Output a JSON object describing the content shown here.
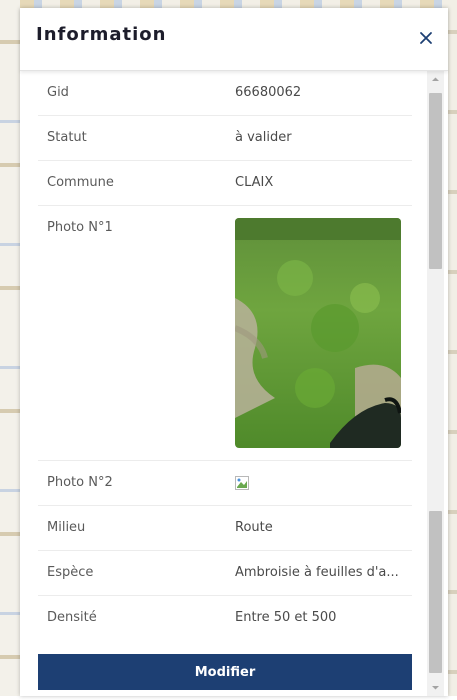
{
  "panel": {
    "title": "Information",
    "close_icon": "close-icon"
  },
  "rows": [
    {
      "label": "Gid",
      "value": "66680062"
    },
    {
      "label": "Statut",
      "value": "à valider"
    },
    {
      "label": "Commune",
      "value": "CLAIX"
    },
    {
      "label": "Photo N°1",
      "value": ""
    },
    {
      "label": "Photo N°2",
      "value": ""
    },
    {
      "label": "Milieu",
      "value": "Route"
    },
    {
      "label": "Espèce",
      "value": "Ambroisie à feuilles d'a..."
    },
    {
      "label": "Densité",
      "value": "Entre 50 et 500"
    }
  ],
  "actions": {
    "modify_label": "Modifier"
  },
  "colors": {
    "button_bg": "#1d3f73",
    "title_color": "#1d1d2b",
    "close_color": "#1d3f73"
  },
  "icons": {
    "photo1": "vegetation-photo",
    "photo2": "broken-image-icon"
  }
}
